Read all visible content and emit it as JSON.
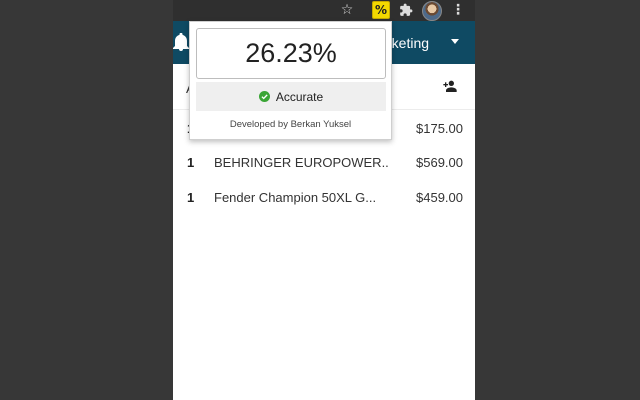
{
  "browser_toolbar": {
    "extension_badge": "%",
    "icons": [
      "star-icon",
      "percent-extension-icon",
      "puzzle-icon",
      "avatar",
      "kebab-menu-icon"
    ]
  },
  "header": {
    "title_partial": "rketing",
    "background_color": "#0f4a63"
  },
  "toolbar": {
    "column_initial": "A"
  },
  "products": [
    {
      "qty": "1",
      "name": "",
      "price": "$175.00"
    },
    {
      "qty": "1",
      "name": "BEHRINGER EUROPOWER...",
      "price": "$569.00"
    },
    {
      "qty": "1",
      "name": "Fender Champion 50XL G...",
      "price": "$459.00"
    }
  ],
  "popup": {
    "score": "26.23%",
    "status": "Accurate",
    "status_color": "#3aa535",
    "footer": "Developed by Berkan Yuksel"
  }
}
